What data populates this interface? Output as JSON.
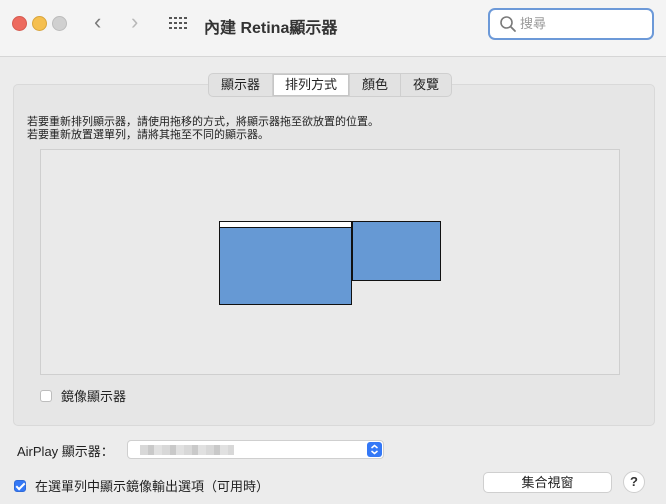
{
  "window": {
    "title": "內建 Retina顯示器"
  },
  "search": {
    "placeholder": "搜尋",
    "value": ""
  },
  "tabs": [
    {
      "label": "顯示器",
      "active": false
    },
    {
      "label": "排列方式",
      "active": true
    },
    {
      "label": "顏色",
      "active": false
    },
    {
      "label": "夜覽",
      "active": false
    }
  ],
  "arrangement": {
    "instruction_line1": "若要重新排列顯示器，請使用拖移的方式，將顯示器拖至欲放置的位置。",
    "instruction_line2": "若要重新放置選單列，請將其拖至不同的顯示器。",
    "display_color": "#6699d4",
    "mirror_label": "鏡像顯示器",
    "mirror_checked": false
  },
  "airplay": {
    "label": "AirPlay 顯示器：",
    "value": ""
  },
  "footer": {
    "menu_option_label": "在選單列中顯示鏡像輸出選項（可用時）",
    "menu_option_checked": true,
    "gather_button": "集合視窗",
    "help_button": "?"
  },
  "colors": {
    "accent": "#3478f6",
    "search_border": "#6c99d8"
  }
}
